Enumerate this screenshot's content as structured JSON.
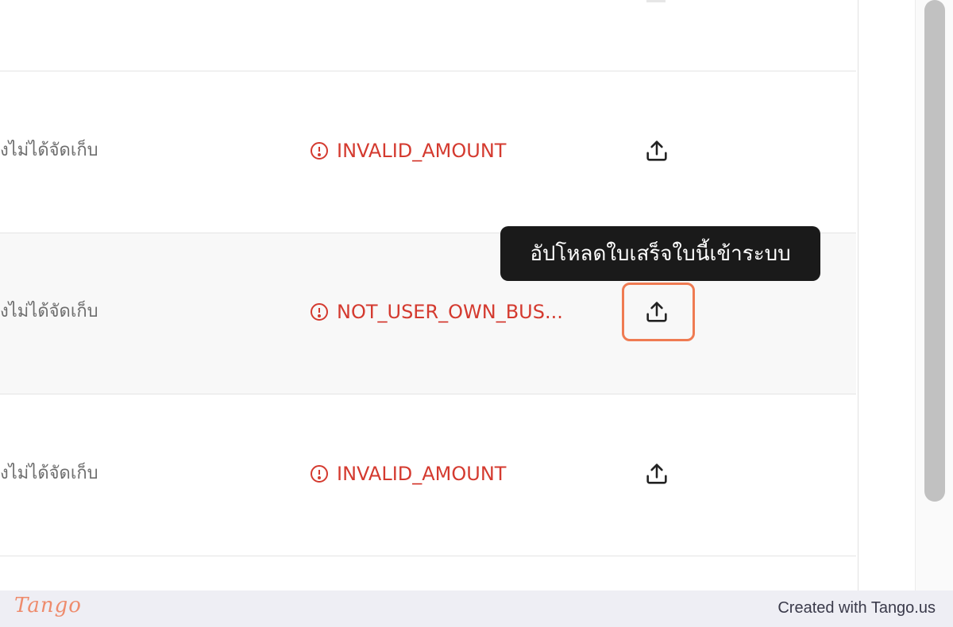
{
  "rows": [
    {
      "status": "ังไม่ได้จัดเก็บ",
      "error": "INVALID_AMOUNT"
    },
    {
      "status": "ังไม่ได้จัดเก็บ",
      "error": "NOT_USER_OWN_BUS..."
    },
    {
      "status": "ังไม่ได้จัดเก็บ",
      "error": "INVALID_AMOUNT"
    }
  ],
  "tooltip": {
    "text": "อัปโหลดใบเสร็จใบนี้เข้าระบบ"
  },
  "icons": {
    "error": "alert-circle-icon",
    "upload": "upload-icon"
  },
  "colors": {
    "error": "#d43a2f",
    "highlight": "#ef7b52",
    "tooltip_bg": "#1a1a1a"
  },
  "footer": {
    "logo": "Tango",
    "credit": "Created with Tango.us"
  }
}
